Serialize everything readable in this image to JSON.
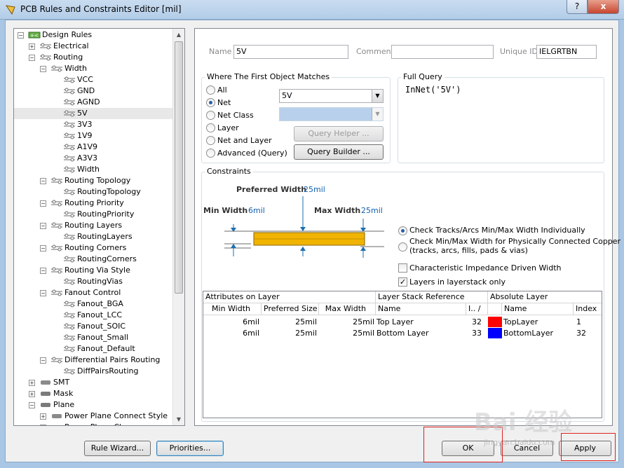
{
  "window": {
    "title": "PCB Rules and Constraints Editor [mil]",
    "help": "?",
    "close": "x"
  },
  "tree": {
    "items": [
      {
        "label": "Design Rules",
        "depth": 0,
        "exp": "-",
        "icon": "rules-root-icon"
      },
      {
        "label": "Electrical",
        "depth": 1,
        "exp": "+",
        "icon": "electrical-icon"
      },
      {
        "label": "Routing",
        "depth": 1,
        "exp": "-",
        "icon": "routing-icon"
      },
      {
        "label": "Width",
        "depth": 2,
        "exp": "-",
        "icon": "rule-icon"
      },
      {
        "label": "VCC",
        "depth": 3,
        "icon": "rule-icon"
      },
      {
        "label": "GND",
        "depth": 3,
        "icon": "rule-icon"
      },
      {
        "label": "AGND",
        "depth": 3,
        "icon": "rule-icon"
      },
      {
        "label": "5V",
        "depth": 3,
        "icon": "rule-icon",
        "selected": true
      },
      {
        "label": "3V3",
        "depth": 3,
        "icon": "rule-icon"
      },
      {
        "label": "1V9",
        "depth": 3,
        "icon": "rule-icon"
      },
      {
        "label": "A1V9",
        "depth": 3,
        "icon": "rule-icon"
      },
      {
        "label": "A3V3",
        "depth": 3,
        "icon": "rule-icon"
      },
      {
        "label": "Width",
        "depth": 3,
        "icon": "rule-icon"
      },
      {
        "label": "Routing Topology",
        "depth": 2,
        "exp": "-",
        "icon": "rule-icon"
      },
      {
        "label": "RoutingTopology",
        "depth": 3,
        "icon": "rule-icon"
      },
      {
        "label": "Routing Priority",
        "depth": 2,
        "exp": "-",
        "icon": "rule-icon"
      },
      {
        "label": "RoutingPriority",
        "depth": 3,
        "icon": "rule-icon"
      },
      {
        "label": "Routing Layers",
        "depth": 2,
        "exp": "-",
        "icon": "rule-icon"
      },
      {
        "label": "RoutingLayers",
        "depth": 3,
        "icon": "rule-icon"
      },
      {
        "label": "Routing Corners",
        "depth": 2,
        "exp": "-",
        "icon": "rule-icon"
      },
      {
        "label": "RoutingCorners",
        "depth": 3,
        "icon": "rule-icon"
      },
      {
        "label": "Routing Via Style",
        "depth": 2,
        "exp": "-",
        "icon": "rule-icon"
      },
      {
        "label": "RoutingVias",
        "depth": 3,
        "icon": "rule-icon"
      },
      {
        "label": "Fanout Control",
        "depth": 2,
        "exp": "-",
        "icon": "rule-icon"
      },
      {
        "label": "Fanout_BGA",
        "depth": 3,
        "icon": "rule-icon"
      },
      {
        "label": "Fanout_LCC",
        "depth": 3,
        "icon": "rule-icon"
      },
      {
        "label": "Fanout_SOIC",
        "depth": 3,
        "icon": "rule-icon"
      },
      {
        "label": "Fanout_Small",
        "depth": 3,
        "icon": "rule-icon"
      },
      {
        "label": "Fanout_Default",
        "depth": 3,
        "icon": "rule-icon"
      },
      {
        "label": "Differential Pairs Routing",
        "depth": 2,
        "exp": "-",
        "icon": "rule-icon"
      },
      {
        "label": "DiffPairsRouting",
        "depth": 3,
        "icon": "rule-icon"
      },
      {
        "label": "SMT",
        "depth": 1,
        "exp": "+",
        "icon": "smt-icon"
      },
      {
        "label": "Mask",
        "depth": 1,
        "exp": "+",
        "icon": "mask-icon"
      },
      {
        "label": "Plane",
        "depth": 1,
        "exp": "-",
        "icon": "plane-icon"
      },
      {
        "label": "Power Plane Connect Style",
        "depth": 2,
        "exp": "+",
        "icon": "plane-rule-icon"
      },
      {
        "label": "Power Plane Clearance",
        "depth": 2,
        "exp": "+",
        "icon": "plane-rule-icon"
      }
    ]
  },
  "rule": {
    "name_label": "Name",
    "name_value": "5V",
    "comment_label": "Comment",
    "comment_value": "",
    "uid_label": "Unique ID",
    "uid_value": "IELGRTBN"
  },
  "match": {
    "title": "Where The First Object Matches",
    "options": [
      "All",
      "Net",
      "Net Class",
      "Layer",
      "Net and Layer",
      "Advanced (Query)"
    ],
    "selected": "Net",
    "net_value": "5V",
    "query_helper": "Query Helper ...",
    "query_builder": "Query Builder ..."
  },
  "full_query": {
    "title": "Full Query",
    "text": "InNet('5V')"
  },
  "constraints": {
    "title": "Constraints",
    "preferred_label": "Preferred Width",
    "preferred_value": "25mil",
    "min_label": "Min Width",
    "min_value": "6mil",
    "max_label": "Max Width",
    "max_value": "25mil",
    "opt_individual": "Check Tracks/Arcs Min/Max Width Individually",
    "opt_connected_1": "Check Min/Max Width for Physically Connected Copper",
    "opt_connected_2": "(tracks, arcs, fills, pads & vias)",
    "chk_impedance": "Characteristic Impedance Driven Width",
    "chk_impedance_on": false,
    "chk_layerstack": "Layers in layerstack only",
    "chk_layerstack_on": true
  },
  "table": {
    "group_attr": "Attributes on Layer",
    "group_stack": "Layer Stack Reference",
    "group_abs": "Absolute Layer",
    "cols": [
      "Min Width",
      "Preferred Size",
      "Max Width",
      "Name",
      "I..",
      "Name",
      "Index"
    ],
    "rows": [
      {
        "min": "6mil",
        "pref": "25mil",
        "max": "25mil",
        "stack_name": "Top Layer",
        "stack_idx": "32",
        "color": "#ff0000",
        "abs_name": "TopLayer",
        "abs_idx": "1"
      },
      {
        "min": "6mil",
        "pref": "25mil",
        "max": "25mil",
        "stack_name": "Bottom Layer",
        "stack_idx": "33",
        "color": "#0000ff",
        "abs_name": "BottomLayer",
        "abs_idx": "32"
      }
    ]
  },
  "buttons": {
    "wizard": "Rule Wizard...",
    "priorities": "Priorities...",
    "ok": "OK",
    "cancel": "Cancel",
    "apply": "Apply"
  },
  "watermark": {
    "text": "Bai 经验",
    "url": "jingyan.baidu.com"
  }
}
